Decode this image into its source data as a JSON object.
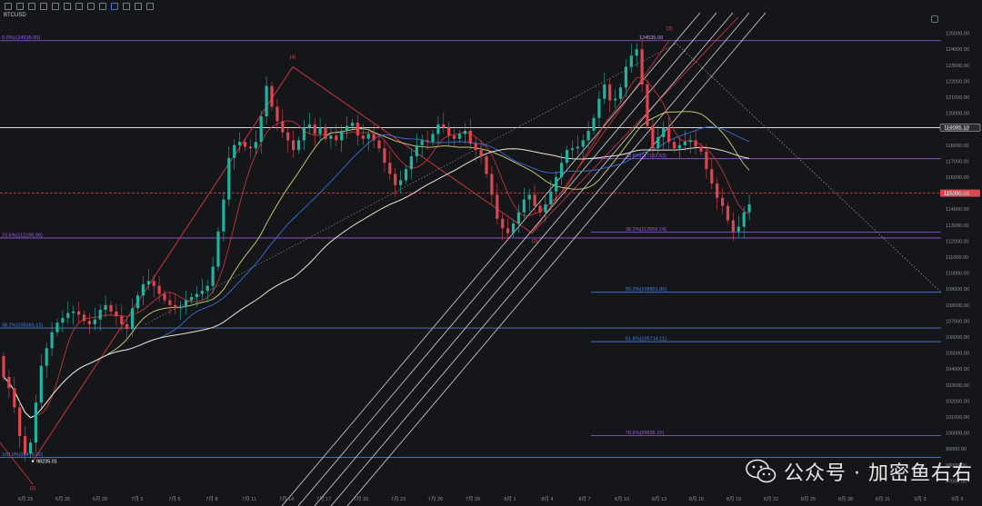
{
  "header": {
    "symbol": "BTCUSD",
    "ohlc_text": "",
    "change_text": ""
  },
  "icons": [
    "trend-line-icon",
    "horizontal-line-icon",
    "fib-icon",
    "brush-icon",
    "text-icon",
    "measure-icon",
    "magnet-icon",
    "lock-icon",
    "trash-icon",
    "undo-icon",
    "redo-icon",
    "settings-icon"
  ],
  "colors": {
    "background": "#151619",
    "up": "#22b3a0",
    "down": "#e0454f",
    "fib_purple": "#9a5ce6",
    "fib_blue": "#4a7de0",
    "ma_yellow": "#d9cf7a",
    "ma_white": "#e9e6d3",
    "ma_blue": "#3a6fd6",
    "ma_red": "#c2343a",
    "channel": "#d8d8d8",
    "wedge_red": "#c2343a"
  },
  "chart_data": {
    "type": "candlestick",
    "title": "",
    "xlabel": "",
    "ylabel": "",
    "price_ticks": [
      "125000.00",
      "124000.00",
      "123000.00",
      "122000.00",
      "121000.00",
      "120000.00",
      "119000.00",
      "118000.00",
      "117000.00",
      "116000.00",
      "115000.00",
      "114000.00",
      "113000.00",
      "112000.00",
      "111000.00",
      "110000.00",
      "109000.00",
      "108000.00",
      "107000.00",
      "106000.00",
      "105000.00",
      "104000.00",
      "103000.00",
      "102000.00",
      "101000.00",
      "100000.00",
      "99000.00",
      "98000.00",
      "97000.00"
    ],
    "date_ticks": [
      "6月 23",
      "6月 26",
      "6月 29",
      "7月 2",
      "7月 5",
      "7月 8",
      "7月 11",
      "7月 14",
      "7月 17",
      "7月 20",
      "7月 23",
      "7月 26",
      "7月 29",
      "8月 1",
      "8月 4",
      "8月 7",
      "8月 10",
      "8月 13",
      "8月 16",
      "8月 19",
      "8月 22",
      "8月 25",
      "8月 28",
      "8月 31",
      "9月 3",
      "9月 6"
    ],
    "current_price": "115000.00",
    "crosshair_price": "119095.18",
    "low_label": "98235.01",
    "high_label": "124535.00",
    "fib_levels": [
      {
        "label": "0.0%(124535.00)",
        "price": 124535,
        "color": "#9a5ce6",
        "side": "left"
      },
      {
        "label": "23.6%(117152.63)",
        "price": 117152,
        "color": "#9a5ce6",
        "side": "right"
      },
      {
        "label": "38.2%(112556.14)",
        "price": 112556,
        "color": "#9a5ce6",
        "side": "right"
      },
      {
        "label": "50.0%(108801.80)",
        "price": 108801,
        "color": "#4a7de0",
        "side": "right"
      },
      {
        "label": "61.8%(105714.11)",
        "price": 105714,
        "color": "#4a7de0",
        "side": "right"
      },
      {
        "label": "78.6%(99835.15)",
        "price": 99835,
        "color": "#9a5ce6",
        "side": "right"
      },
      {
        "label": "23.6%(112196.98)",
        "price": 112196,
        "color": "#9a5ce6",
        "side": "left"
      },
      {
        "label": "38.2%(106565.15)",
        "price": 106565,
        "color": "#4a7de0",
        "side": "left"
      },
      {
        "label": "100.0%(98478.00)",
        "price": 98478,
        "color": "#4a7de0",
        "side": "left"
      }
    ],
    "wave_labels": [
      "(2)",
      "(4)",
      "(2)",
      "(3)"
    ],
    "closes": [
      103500,
      102800,
      101600,
      99800,
      98700,
      99400,
      101900,
      104200,
      105300,
      106300,
      106900,
      107200,
      107500,
      107600,
      107400,
      107000,
      106800,
      107100,
      107700,
      108000,
      107600,
      107300,
      106800,
      106500,
      107800,
      108600,
      109300,
      109500,
      109200,
      108700,
      108300,
      108000,
      107800,
      107900,
      108300,
      108500,
      108700,
      108900,
      109200,
      110400,
      112600,
      114600,
      117200,
      118000,
      118200,
      117900,
      117800,
      118200,
      119800,
      121700,
      120400,
      119500,
      118800,
      118300,
      117700,
      118300,
      119100,
      119300,
      118700,
      119100,
      118400,
      118600,
      118300,
      118900,
      119200,
      119400,
      118600,
      118400,
      118700,
      118300,
      117800,
      116900,
      116200,
      115500,
      115800,
      116500,
      117300,
      118000,
      118300,
      118200,
      118700,
      119300,
      119100,
      118600,
      118400,
      118700,
      118900,
      118100,
      117700,
      117300,
      116200,
      114900,
      113400,
      112800,
      112500,
      113100,
      113800,
      114600,
      114900,
      114200,
      113800,
      114300,
      115100,
      116000,
      116900,
      117700,
      117800,
      117900,
      118300,
      118900,
      119700,
      120900,
      121800,
      120800,
      120900,
      121600,
      122900,
      123600,
      124000,
      121800,
      119200,
      117800,
      118500,
      119100,
      118200,
      117800,
      118000,
      118200,
      118300,
      117900,
      117600,
      116500,
      115600,
      114700,
      114200,
      113300,
      112600,
      112900,
      113800,
      114300
    ]
  }
}
